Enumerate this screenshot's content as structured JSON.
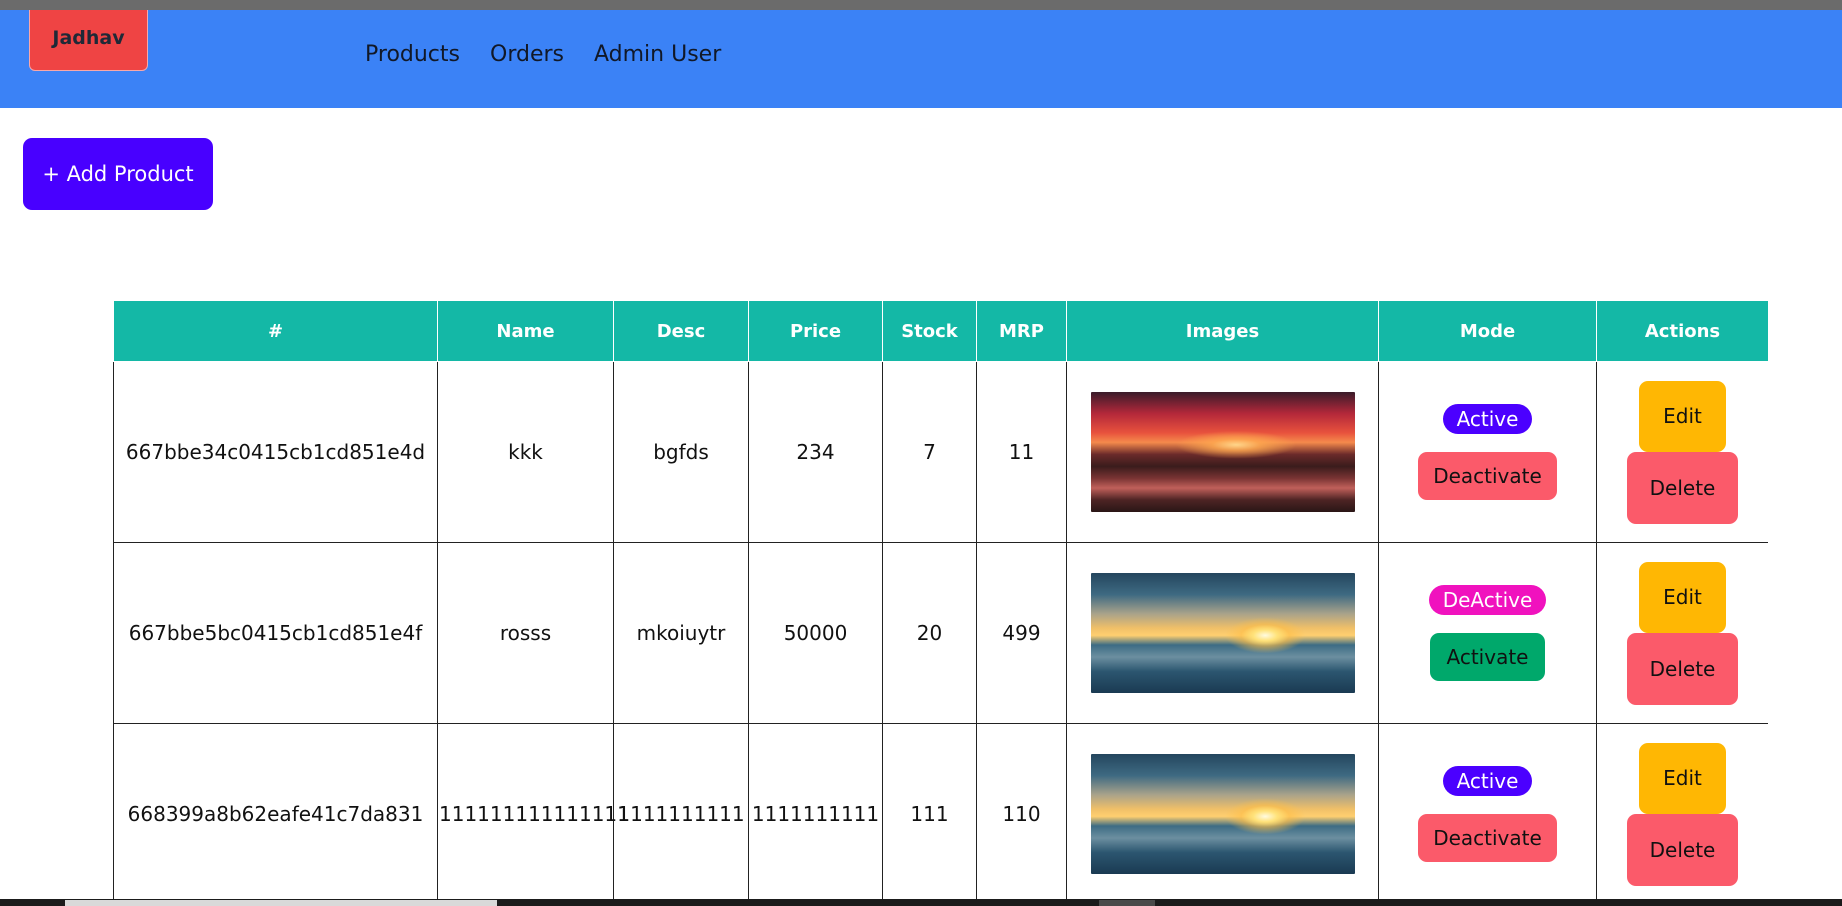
{
  "navbar": {
    "brand": "Jadhav",
    "links": [
      "Products",
      "Orders",
      "Admin User"
    ],
    "background": "#3b82f6",
    "brand_color": "#ef4444"
  },
  "toolbar": {
    "add_product_label": "+ Add Product",
    "accent": "#4800ff"
  },
  "table": {
    "headers": [
      "#",
      "Name",
      "Desc",
      "Price",
      "Stock",
      "MRP",
      "Images",
      "Mode",
      "Actions"
    ],
    "header_color": "#14b8a6",
    "rows": [
      {
        "id": "667bbe34c0415cb1cd851e4d",
        "name": "kkk",
        "desc": "bgfds",
        "price": "234",
        "stock": "7",
        "mrp": "11",
        "image": "sunset-over-rocky-shore",
        "mode_status": "Active",
        "mode_action": "Deactivate",
        "edit_label": "Edit",
        "delete_label": "Delete"
      },
      {
        "id": "667bbe5bc0415cb1cd851e4f",
        "name": "rosss",
        "desc": "mkoiuytr",
        "price": "50000",
        "stock": "20",
        "mrp": "499",
        "image": "sunset-over-sea-waves",
        "mode_status": "DeActive",
        "mode_action": "Activate",
        "edit_label": "Edit",
        "delete_label": "Delete"
      },
      {
        "id": "668399a8b62eafe41c7da831",
        "name": "111111111111111",
        "desc": "1111111111",
        "price": "1111111111",
        "stock": "111",
        "mrp": "110",
        "image": "sunset-over-sea-waves",
        "mode_status": "Active",
        "mode_action": "Deactivate",
        "edit_label": "Edit",
        "delete_label": "Delete"
      }
    ]
  },
  "colors": {
    "active_badge": "#4b00ff",
    "deactive_badge": "#f012be",
    "deactivate_button": "#fb5a6a",
    "activate_button": "#00a86b",
    "edit_button": "#ffb703",
    "delete_button": "#fb5a6a"
  }
}
